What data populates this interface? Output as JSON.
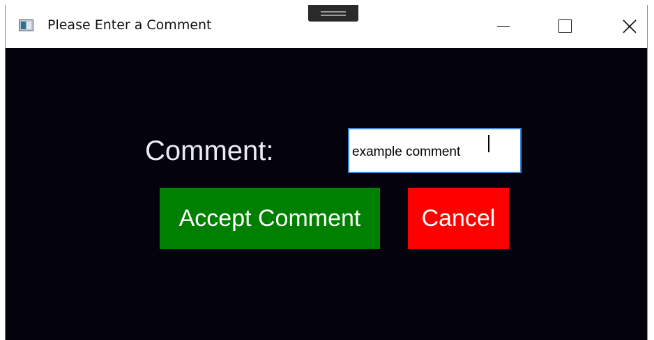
{
  "window": {
    "title": "Please Enter a Comment",
    "icon": "app-window-icon",
    "controls": {
      "minimize_icon": "minimize-icon",
      "maximize_icon": "maximize-icon",
      "close_icon": "close-icon"
    },
    "background_color": "#04030d"
  },
  "form": {
    "comment_label": "Comment:",
    "comment_value": "example comment",
    "accept_label": "Accept Comment",
    "cancel_label": "Cancel"
  },
  "colors": {
    "accept_button": "#008000",
    "cancel_button": "#ff0000",
    "input_border": "#3c8ad6",
    "label_text": "#ecebf4"
  }
}
